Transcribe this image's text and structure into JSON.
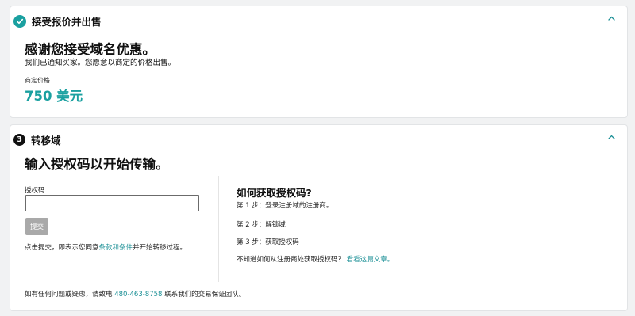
{
  "accept_section": {
    "title": "接受报价并出售",
    "heading": "感谢您接受域名优惠。",
    "message": "我们已通知买家。您愿意以商定的价格出售。",
    "price_label": "商定价格",
    "price_value": "750 美元"
  },
  "transfer_section": {
    "step_number": "3",
    "title": "转移域",
    "heading": "输入授权码以开始传输。",
    "auth_code_label": "授权码",
    "auth_code_value": "",
    "auth_code_placeholder": "",
    "submit_label": "提交",
    "terms_prefix": "点击提交，即表示您同意",
    "terms_link": "条款和条件",
    "terms_suffix": "并开始转移过程。",
    "howto_title": "如何获取授权码?",
    "howto_steps": [
      "第 1 步：登录注册域的注册商。",
      "第 2 步：解锁域",
      "第 3 步：获取授权码"
    ],
    "help_text": "不知道如何从注册商处获取授权码？",
    "help_link": "看看这篇文章。",
    "contact_prefix": "如有任何问题或疑虑，请致电 ",
    "contact_phone": "480-463-8758",
    "contact_suffix": " 联系我们的交易保证团队。"
  },
  "colors": {
    "accent": "#1aa0a0",
    "link": "#1a8f95",
    "button_disabled": "#a9a9a9"
  },
  "icons": {
    "completed": "checkmark-circle-icon",
    "collapse": "chevron-up-icon"
  }
}
